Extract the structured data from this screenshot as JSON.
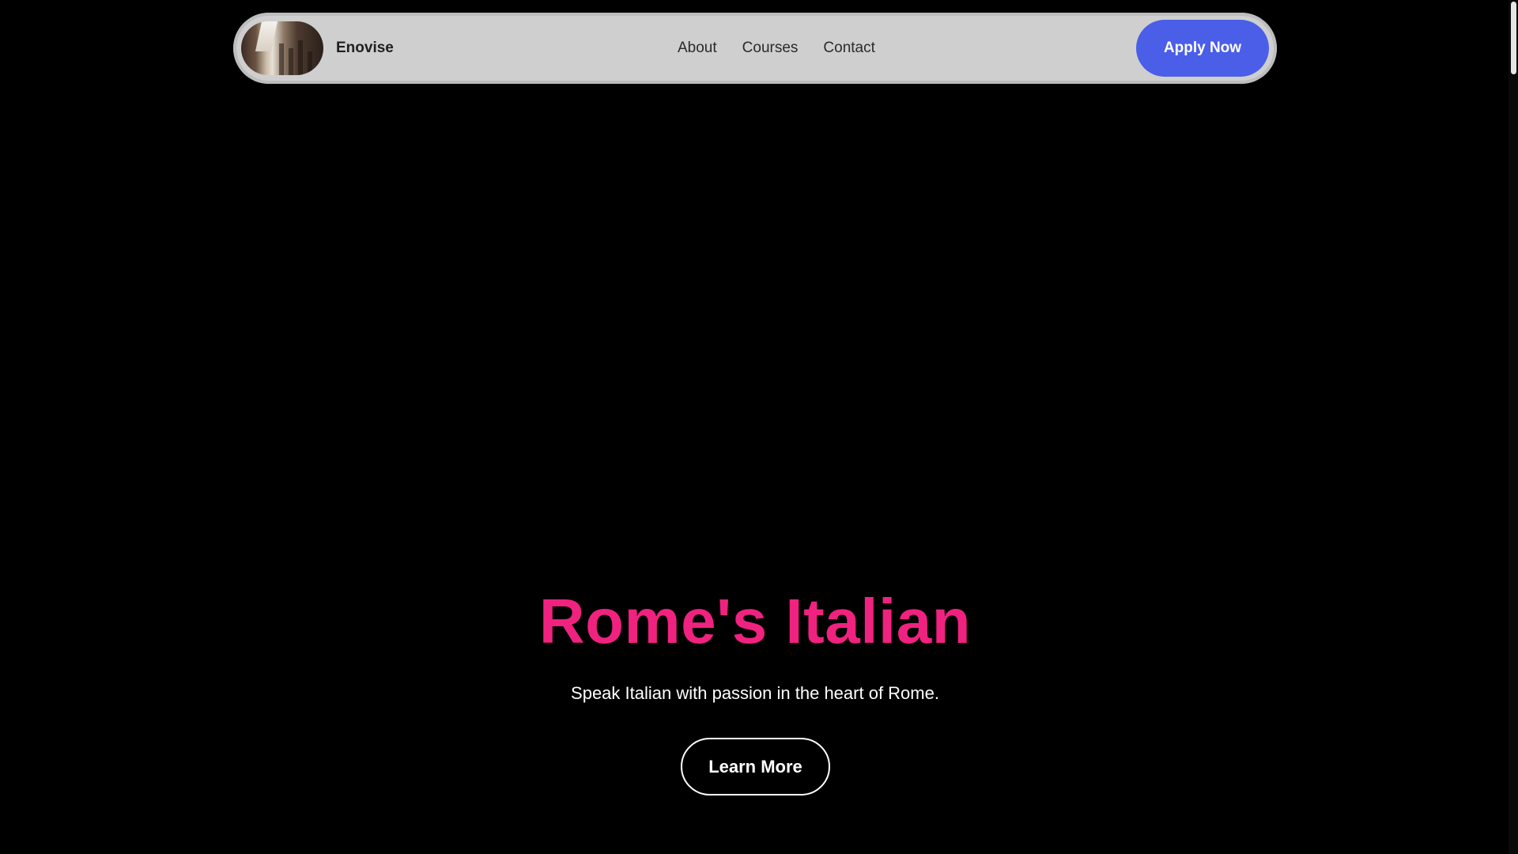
{
  "navbar": {
    "brand_name": "Enovise",
    "links": [
      "About",
      "Courses",
      "Contact"
    ],
    "cta_label": "Apply Now"
  },
  "hero": {
    "title": "Rome's Italian",
    "subtitle": "Speak Italian with passion in the heart of Rome.",
    "cta_label": "Learn More"
  },
  "colors": {
    "background": "#000000",
    "navbar_bg": "#cfcfcf",
    "accent_pink": "#f0227f",
    "button_blue": "#4a5ee8",
    "text_white": "#ffffff"
  },
  "icons": {
    "logo": "rome-street-photo-logo"
  }
}
